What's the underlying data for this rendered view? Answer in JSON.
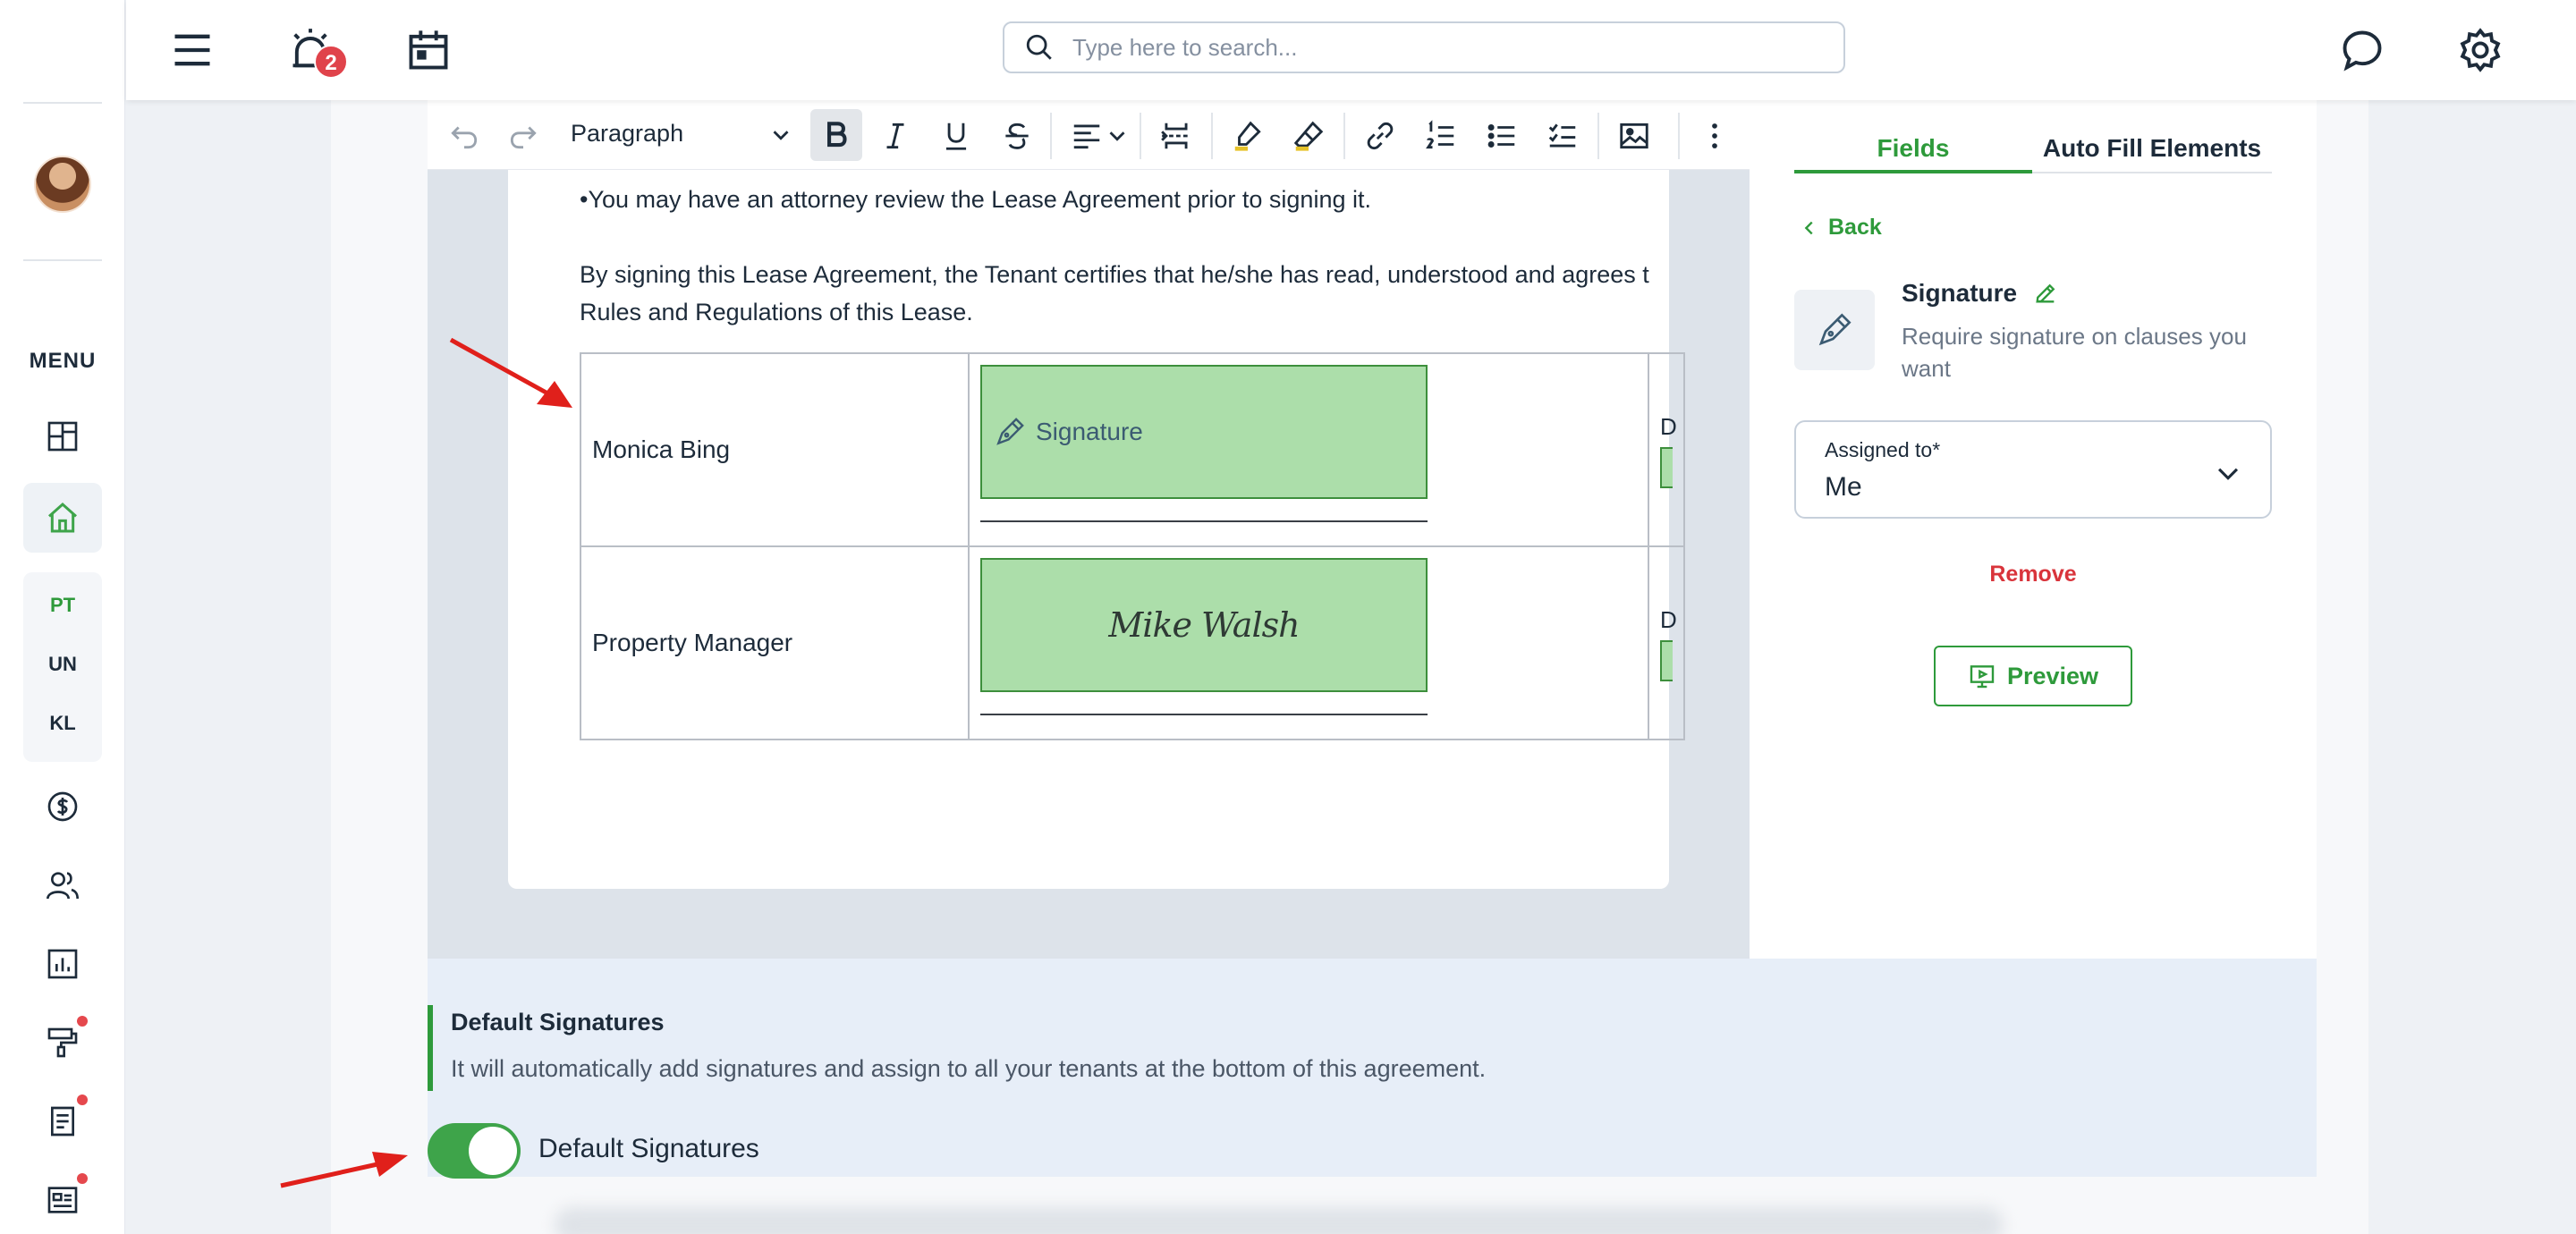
{
  "sidebar": {
    "menu_label": "MENU",
    "tenant_abbreviations": [
      "PT",
      "UN",
      "KL"
    ]
  },
  "topbar": {
    "notification_count": "2",
    "search": {
      "placeholder": "Type here to search..."
    }
  },
  "editor": {
    "toolbar": {
      "paragraph_style": "Paragraph"
    },
    "document": {
      "line1": "•You may have an attorney review the Lease Agreement prior to signing it.",
      "line2": "By signing this Lease Agreement, the Tenant certifies that he/she has read, understood and agrees t",
      "line3": "Rules and Regulations of this Lease."
    },
    "signature_table": [
      {
        "name": "Monica Bing",
        "signature_placeholder": "Signature",
        "date_stub": "D"
      },
      {
        "name": "Property Manager",
        "signature_script": "Mike Walsh",
        "date_stub": "D"
      }
    ]
  },
  "panel": {
    "tabs": [
      "Fields",
      "Auto Fill Elements"
    ],
    "active_tab": "Fields",
    "back_label": "Back",
    "field_title": "Signature",
    "field_description": "Require signature on clauses you want",
    "assigned_label": "Assigned to*",
    "assigned_value": "Me",
    "remove_label": "Remove",
    "preview_label": "Preview"
  },
  "default_signatures": {
    "title": "Default Signatures",
    "description": "It will automatically add signatures and assign to all your tenants at the bottom of this agreement.",
    "toggle_label": "Default Signatures",
    "toggle_on": true
  },
  "colors": {
    "accent_green": "#2e9a3b",
    "signature_fill": "#acdeaa",
    "danger_red": "#d9343b",
    "annotation_arrow": "#e0201b"
  }
}
